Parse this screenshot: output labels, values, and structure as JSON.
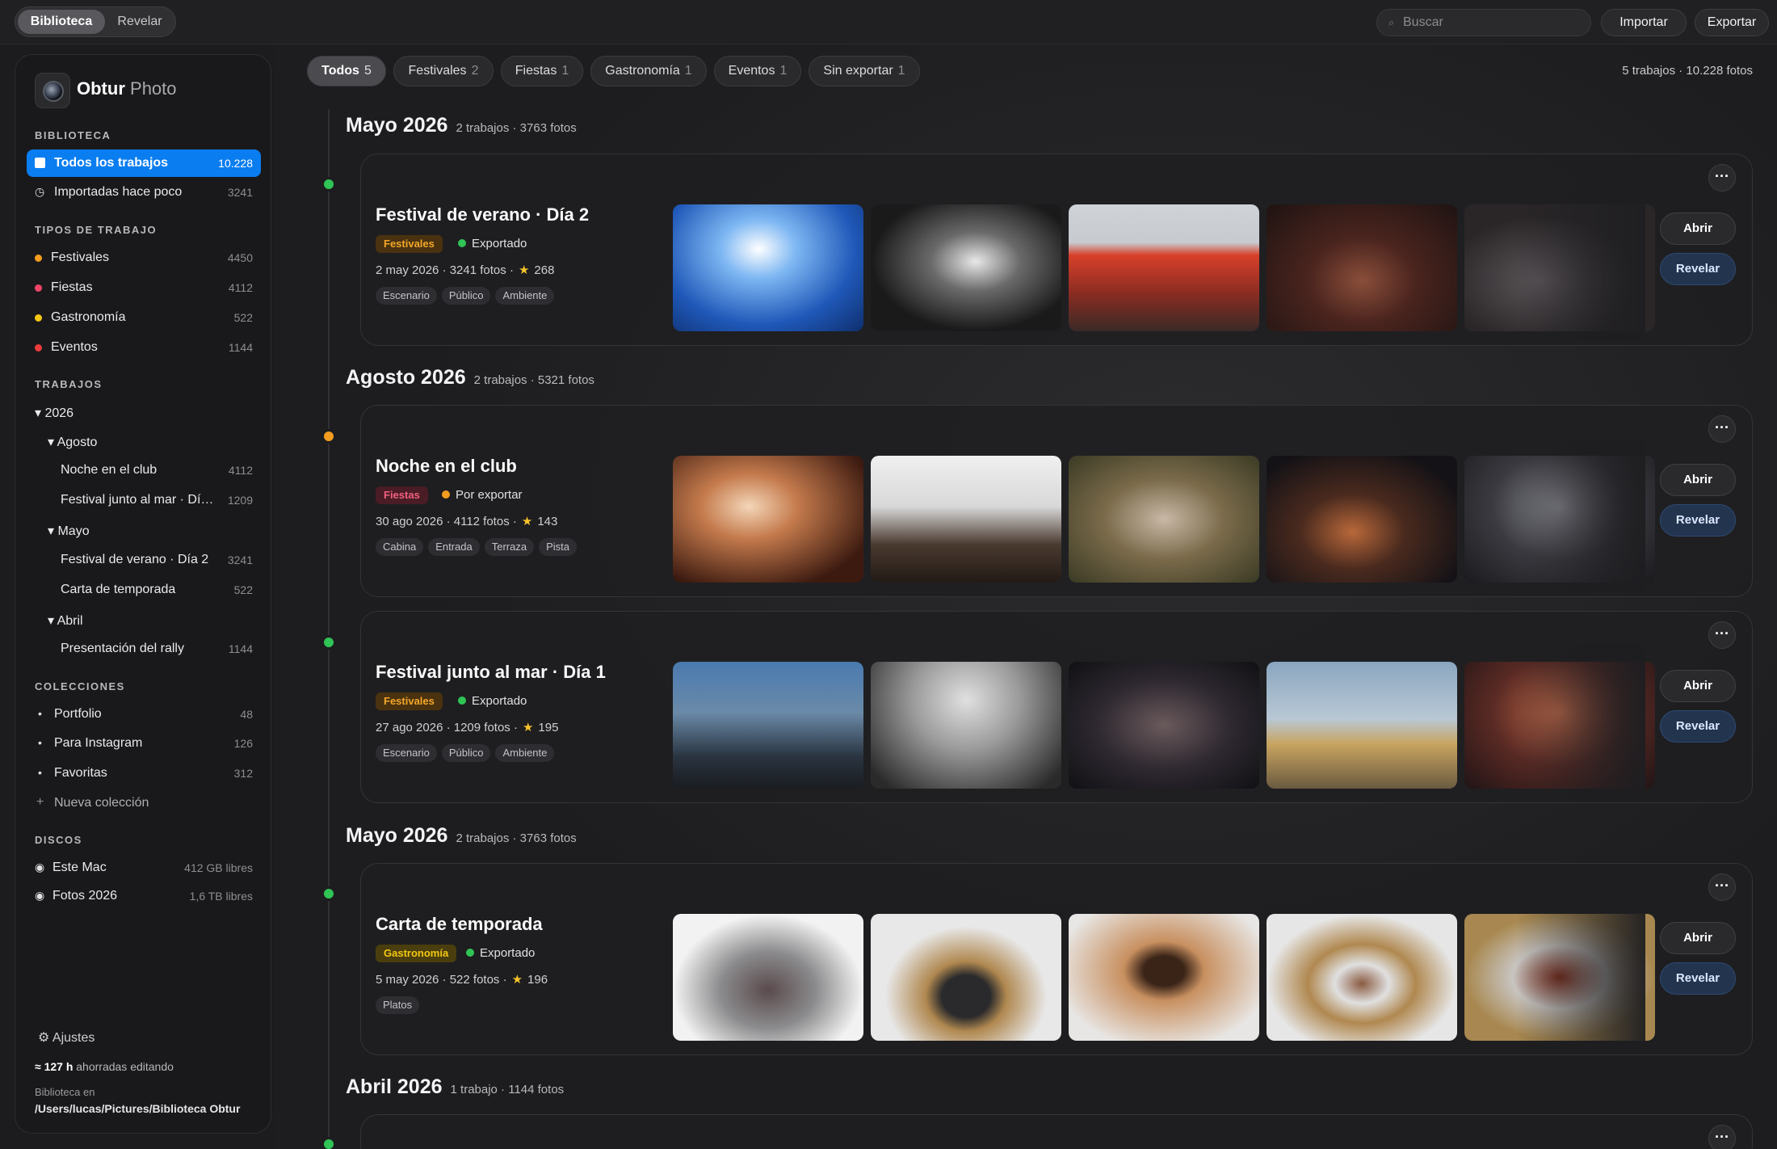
{
  "topbar": {
    "segments": [
      "Biblioteca",
      "Revelar"
    ],
    "search_placeholder": "Buscar",
    "import_label": "Importar",
    "export_label": "Exportar"
  },
  "sidebar": {
    "brand_bold": "Obtur",
    "brand_light": "Photo",
    "library_header": "BIBLIOTECA",
    "library": [
      {
        "label": "Todos los trabajos",
        "count": "10.228"
      },
      {
        "label": "Importadas hace poco",
        "count": "3241"
      }
    ],
    "types_header": "TIPOS DE TRABAJO",
    "types": [
      {
        "label": "Festivales",
        "count": "4450",
        "color": "#f39c1f"
      },
      {
        "label": "Fiestas",
        "count": "4112",
        "color": "#f0446a"
      },
      {
        "label": "Gastronomía",
        "count": "522",
        "color": "#f4c714"
      },
      {
        "label": "Eventos",
        "count": "1144",
        "color": "#ee3b3b"
      }
    ],
    "jobs_header": "TRABAJOS",
    "jobs": [
      {
        "label": "▾ 2026",
        "count": ""
      },
      {
        "label": "▾ Agosto",
        "count": ""
      },
      {
        "label": "Noche en el club",
        "count": "4112"
      },
      {
        "label": "Festival junto al mar · Dí…",
        "count": "1209"
      },
      {
        "label": "▾ Mayo",
        "count": ""
      },
      {
        "label": "Festival de verano · Día 2",
        "count": "3241"
      },
      {
        "label": "Carta de temporada",
        "count": "522"
      },
      {
        "label": "▾ Abril",
        "count": ""
      },
      {
        "label": "Presentación del rally",
        "count": "1144"
      }
    ],
    "collections_header": "COLECCIONES",
    "collections": [
      {
        "label": "Portfolio",
        "count": "48"
      },
      {
        "label": "Para Instagram",
        "count": "126"
      },
      {
        "label": "Favoritas",
        "count": "312"
      }
    ],
    "new_collection": "Nueva colección",
    "disks_header": "DISCOS",
    "disks": [
      {
        "label": "Este Mac",
        "count": "412 GB libres"
      },
      {
        "label": "Fotos 2026",
        "count": "1,6 TB libres"
      }
    ],
    "settings": "Ajustes",
    "saved_hours": "≈ 127 h",
    "saved_text": "ahorradas editando",
    "library_loc_label": "Biblioteca en",
    "library_path": "/Users/lucas/Pictures/Biblioteca Obtur"
  },
  "filters": [
    {
      "label": "Todos",
      "count": "5"
    },
    {
      "label": "Festivales",
      "count": "2"
    },
    {
      "label": "Fiestas",
      "count": "1"
    },
    {
      "label": "Gastronomía",
      "count": "1"
    },
    {
      "label": "Eventos",
      "count": "1"
    },
    {
      "label": "Sin exportar",
      "count": "1"
    }
  ],
  "summary": "5 trabajos · 10.228 fotos",
  "months": [
    {
      "title": "Mayo 2026",
      "sub": "2 trabajos · 3763 fotos"
    },
    {
      "title": "Agosto 2026",
      "sub": "2 trabajos · 5321 fotos"
    },
    {
      "title": "Mayo 2026",
      "sub": "2 trabajos · 3763 fotos"
    },
    {
      "title": "Abril 2026",
      "sub": "1 trabajo · 1144 fotos"
    }
  ],
  "cards": [
    {
      "title": "Festival de verano · Día 2",
      "badge": "Festivales",
      "status": "Exportado",
      "status_color": "#2fc455",
      "meta": "2 may 2026 · 3241 fotos ·",
      "rating": "268",
      "tags": [
        "Escenario",
        "Público",
        "Ambiente"
      ]
    },
    {
      "title": "Noche en el club",
      "badge": "Fiestas",
      "status": "Por exportar",
      "status_color": "#f39c1f",
      "meta": "30 ago 2026 · 4112 fotos ·",
      "rating": "143",
      "tags": [
        "Cabina",
        "Entrada",
        "Terraza",
        "Pista"
      ]
    },
    {
      "title": "Festival junto al mar · Día 1",
      "badge": "Festivales",
      "status": "Exportado",
      "status_color": "#2fc455",
      "meta": "27 ago 2026 · 1209 fotos ·",
      "rating": "195",
      "tags": [
        "Escenario",
        "Público",
        "Ambiente"
      ]
    },
    {
      "title": "Carta de temporada",
      "badge": "Gastronomía",
      "status": "Exportado",
      "status_color": "#2fc455",
      "meta": "5 may 2026 · 522 fotos ·",
      "rating": "196",
      "tags": [
        "Platos"
      ]
    }
  ],
  "card_actions": {
    "open": "Abrir",
    "reveal": "Revelar",
    "more": "···"
  }
}
